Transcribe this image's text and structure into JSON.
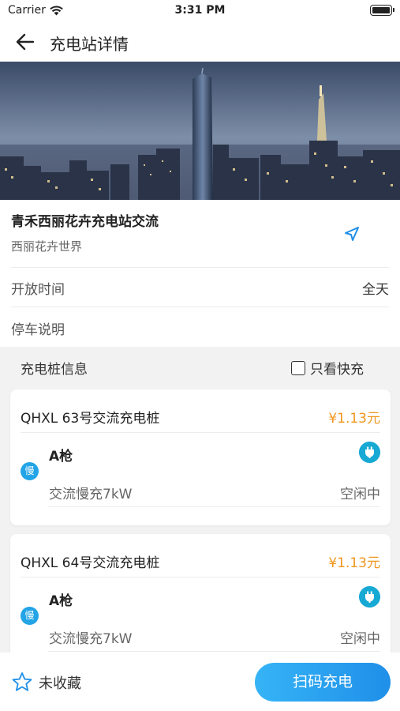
{
  "status_bar": {
    "carrier": "Carrier",
    "time": "3:31 PM"
  },
  "nav": {
    "title": "充电站详情"
  },
  "station": {
    "name": "青禾西丽花卉充电站交流",
    "address": "西丽花卉世界",
    "open_time_label": "开放时间",
    "open_time_value": "全天",
    "parking_label": "停车说明"
  },
  "piles_header": {
    "label": "充电桩信息",
    "fast_only_label": "只看快充"
  },
  "piles": [
    {
      "name": "QHXL 63号交流充电桩",
      "price": "¥1.13元",
      "badge": "慢",
      "gun": "A枪",
      "type": "交流慢充7kW",
      "status": "空闲中"
    },
    {
      "name": "QHXL 64号交流充电桩",
      "price": "¥1.13元",
      "badge": "慢",
      "gun": "A枪",
      "type": "交流慢充7kW",
      "status": "空闲中"
    }
  ],
  "bottom": {
    "favorite_label": "未收藏",
    "scan_label": "扫码充电"
  },
  "colors": {
    "accent": "#22a4e6",
    "price": "#f0961e",
    "button": "#1f8fe8"
  },
  "icons": [
    "wifi-icon",
    "battery-icon",
    "back-arrow-icon",
    "navigate-icon",
    "checkbox-icon",
    "plug-icon",
    "star-icon"
  ]
}
